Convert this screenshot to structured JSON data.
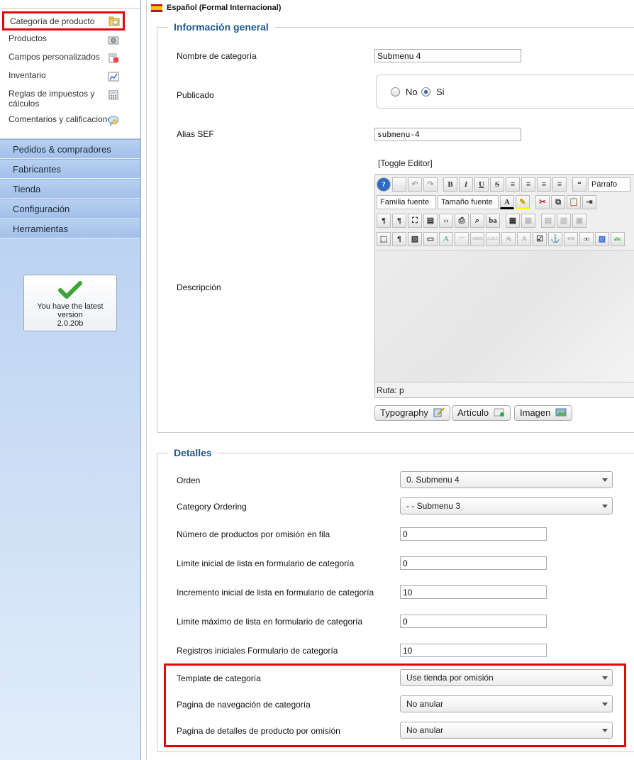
{
  "sidebar": {
    "submenu": [
      {
        "label": "Categoría de producto",
        "icon": "folder-icon"
      },
      {
        "label": "Productos",
        "icon": "camera-icon"
      },
      {
        "label": "Campos personalizados",
        "icon": "form-icon"
      },
      {
        "label": "Inventario",
        "icon": "chart-icon"
      },
      {
        "label": "Reglas de impuestos y cálculos",
        "icon": "calculator-icon"
      },
      {
        "label": "Comentarios y calificaciones",
        "icon": "speech-bubble-icon"
      }
    ],
    "mainmenu": [
      "Pedidos & compradores",
      "Fabricantes",
      "Tienda",
      "Configuración",
      "Herramientas"
    ],
    "version": {
      "line1": "You have the latest",
      "line2": "version",
      "line3": "2.0.20b"
    }
  },
  "header": {
    "language": "Español (Formal Internacional)"
  },
  "general": {
    "legend": "Información general",
    "name_label": "Nombre de categoría",
    "name_value": "Submenu 4",
    "published_label": "Publicado",
    "no_label": "No",
    "yes_label": "Si",
    "published_value": "Si",
    "alias_label": "Alias SEF",
    "alias_value": "submenu-4",
    "toggle_editor": "[Toggle Editor]",
    "description_label": "Descripción",
    "font_family": "Familia fuente",
    "font_size": "Tamaño fuente",
    "paragraph": "Párrafo",
    "path": "Ruta: p",
    "buttons": {
      "typography": "Typography",
      "article": "Artículo",
      "image": "Imagen"
    }
  },
  "details": {
    "legend": "Detalles",
    "order_label": "Orden",
    "order_value": "0. Submenu 4",
    "ordering_label": "Category Ordering",
    "ordering_value": "- - Submenu 3",
    "per_row_label": "Número de productos por omisión en fila",
    "per_row_value": "0",
    "limit_start_label": "Limite inicial de lista en formulario de categoría",
    "limit_start_value": "0",
    "limit_step_label": "Incremento inicial de lista en formulario de categoría",
    "limit_step_value": "10",
    "limit_max_label": "Limite máximo de lista en formulario de categoría",
    "limit_max_value": "0",
    "initial_rows_label": "Registros iniciales Formulario de categoría",
    "initial_rows_value": "10",
    "template_label": "Template de categoría",
    "template_value": "Use tienda por omisión",
    "browse_label": "Pagina de navegación de categoría",
    "browse_value": "No anular",
    "product_details_label": "Pagina de detalles de producto por omisión",
    "product_details_value": "No anular"
  },
  "colors": {
    "highlight": "#e3060f",
    "legend": "#1e5a8c",
    "sidebar": "#a9c6ee"
  }
}
